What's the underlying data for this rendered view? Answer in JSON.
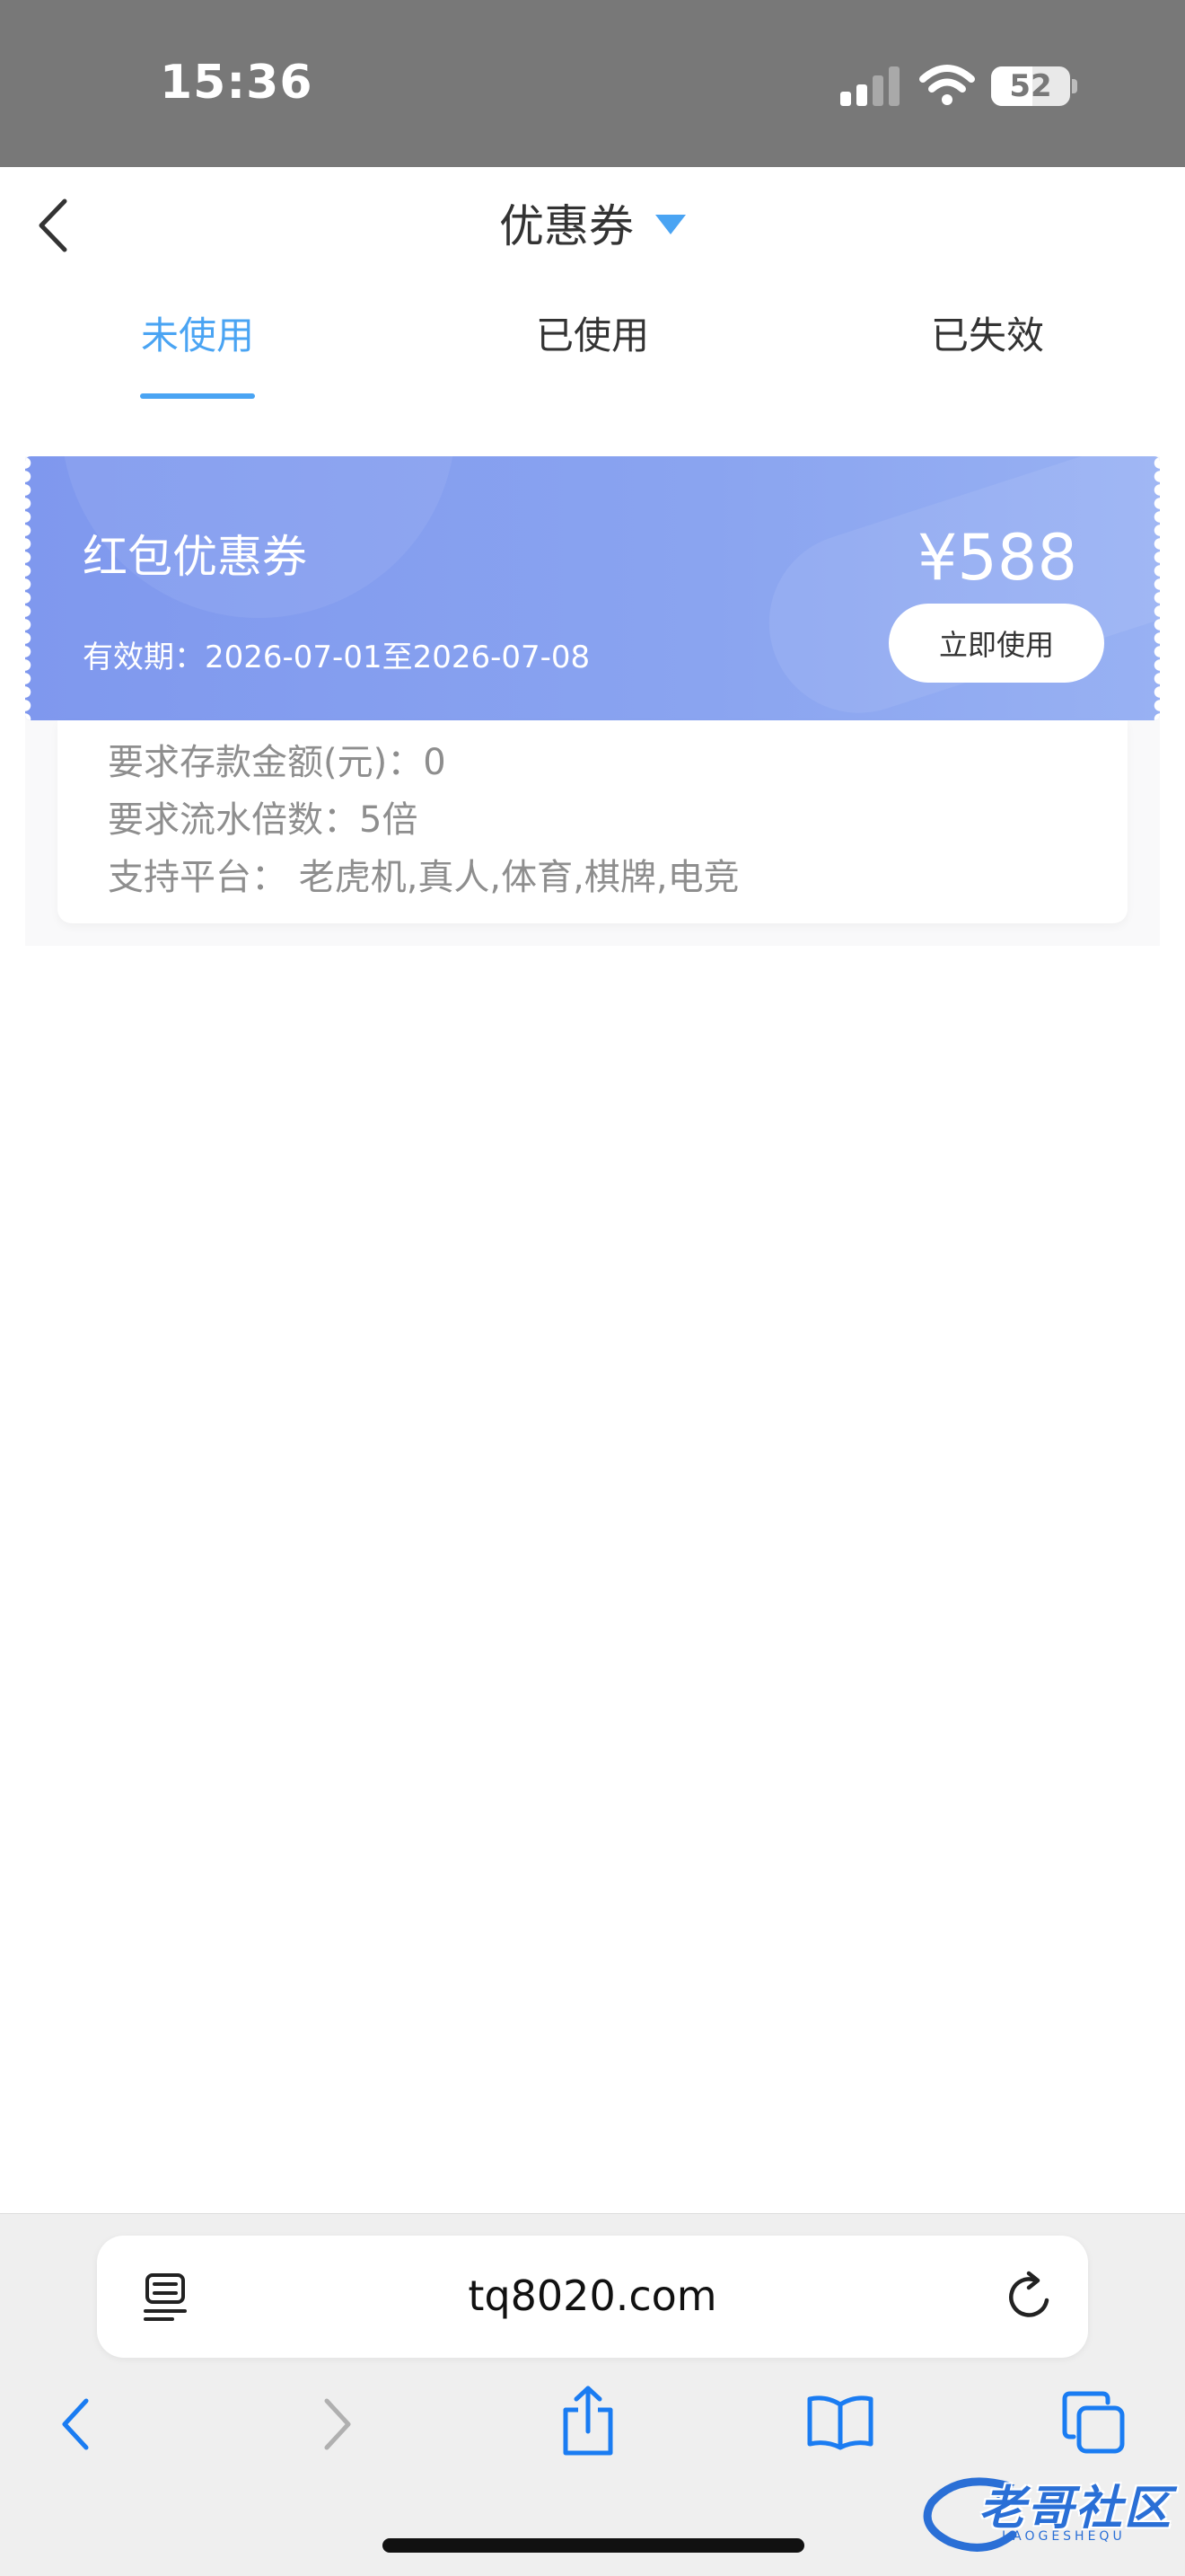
{
  "status_bar": {
    "time": "15:36",
    "battery_level": "52"
  },
  "header": {
    "title": "优惠券"
  },
  "tabs": [
    {
      "label": "未使用",
      "active": true
    },
    {
      "label": "已使用",
      "active": false
    },
    {
      "label": "已失效",
      "active": false
    }
  ],
  "coupon": {
    "name": "红包优惠券",
    "amount": "¥588",
    "validity": "有效期：2026-07-01至2026-07-08",
    "use_button": "立即使用",
    "details": [
      "要求存款金额(元)：0",
      "要求流水倍数：5倍",
      "支持平台：  老虎机,真人,体育,棋牌,电竞"
    ]
  },
  "browser": {
    "url": "tq8020.com"
  },
  "watermark": {
    "text": "老哥社区",
    "subtext": "LAOGESHEQU"
  },
  "colors": {
    "accent": "#4aa4f3",
    "coupon_bg": "#8aa4f0",
    "status_bar_bg": "#787878",
    "browser_blue": "#1a7cf2"
  }
}
